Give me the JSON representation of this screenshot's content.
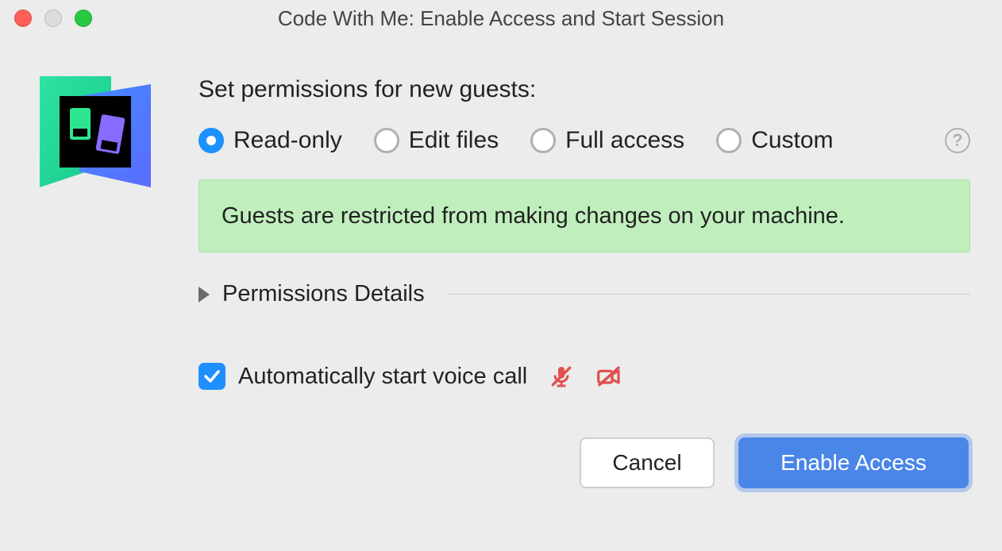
{
  "window": {
    "title": "Code With Me: Enable Access and Start Session"
  },
  "heading": "Set permissions for new guests:",
  "permissions": {
    "options": [
      {
        "label": "Read-only",
        "selected": true
      },
      {
        "label": "Edit files",
        "selected": false
      },
      {
        "label": "Full access",
        "selected": false
      },
      {
        "label": "Custom",
        "selected": false
      }
    ]
  },
  "info_message": "Guests are restricted from making changes on your machine.",
  "details_label": "Permissions Details",
  "voice_call": {
    "label": "Automatically start voice call",
    "checked": true,
    "mic_muted": true,
    "camera_muted": true
  },
  "buttons": {
    "cancel": "Cancel",
    "primary": "Enable Access"
  },
  "colors": {
    "accent": "#1e90ff",
    "info_bg": "#c0efbd",
    "danger": "#e14f4f"
  }
}
